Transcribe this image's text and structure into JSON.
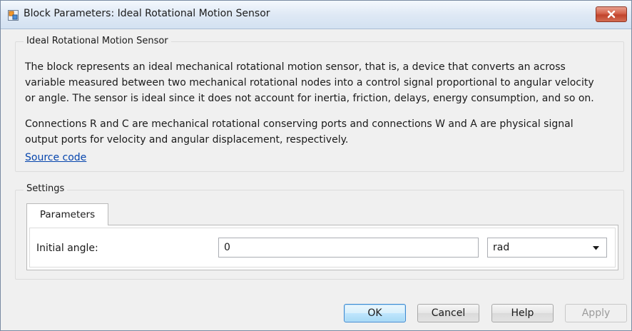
{
  "window": {
    "title": "Block Parameters: Ideal Rotational Motion Sensor",
    "close_icon": "close-icon",
    "app_icon": "simulink-block-icon"
  },
  "description_group": {
    "legend": "Ideal Rotational Motion Sensor",
    "paragraph1_line1": "The block represents an ideal mechanical rotational motion sensor, that is, a device that converts an across",
    "paragraph1_line2": "variable measured between two mechanical rotational nodes into a control signal proportional to angular velocity",
    "paragraph1_line3": "or angle. The sensor is ideal since it does not account for inertia, friction, delays, energy consumption, and so on.",
    "paragraph2_line1": "Connections R and C are mechanical rotational conserving ports and connections W and A are physical signal",
    "paragraph2_line2": "output ports for velocity and angular displacement, respectively.",
    "source_link": "Source code"
  },
  "settings_group": {
    "legend": "Settings",
    "tabs": [
      {
        "label": "Parameters",
        "active": true
      }
    ],
    "initial_angle": {
      "label": "Initial angle:",
      "value": "0",
      "unit": "rad"
    }
  },
  "buttons": {
    "ok": "OK",
    "cancel": "Cancel",
    "help": "Help",
    "apply": "Apply"
  },
  "colors": {
    "link": "#0645ad",
    "close_button": "#c1432c",
    "ok_border": "#3b8ad1"
  }
}
